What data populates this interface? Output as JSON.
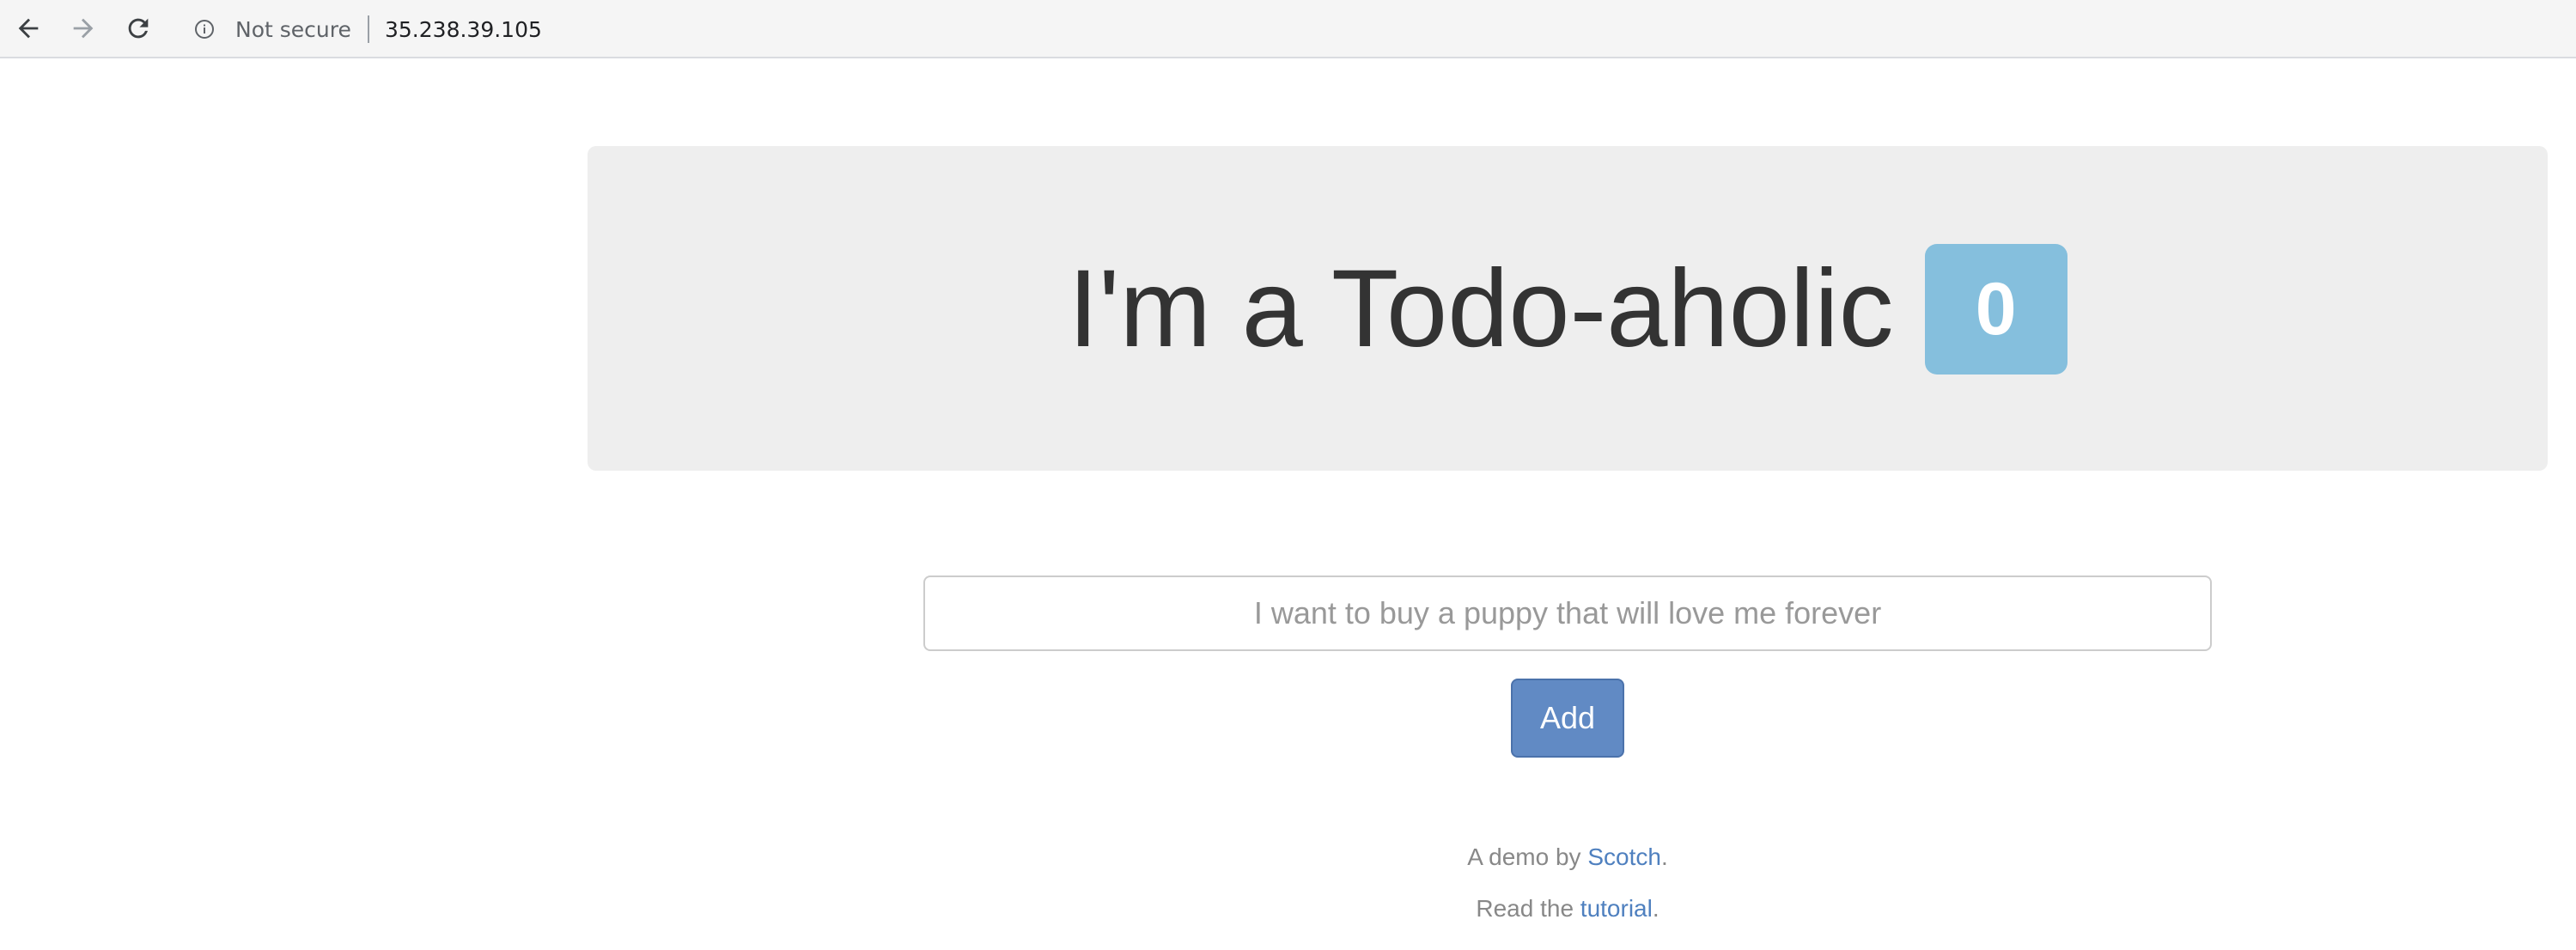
{
  "browser": {
    "security_label": "Not secure",
    "url": "35.238.39.105"
  },
  "icons": {
    "back": "arrow-left-icon",
    "forward": "arrow-right-icon",
    "reload": "reload-icon",
    "info": "info-icon"
  },
  "jumbotron": {
    "title": "I'm a Todo-aholic",
    "todo_count": "0"
  },
  "form": {
    "input_placeholder": "I want to buy a puppy that will love me forever",
    "input_value": "",
    "add_label": "Add"
  },
  "footer": {
    "demo_prefix": "A demo by ",
    "demo_link": "Scotch",
    "demo_suffix": ".",
    "read_prefix": "Read the ",
    "read_link": "tutorial",
    "read_suffix": "."
  },
  "colors": {
    "badge": "#85bfdd",
    "button": "#618ac4",
    "link": "#4f80bf",
    "jumbotron_bg": "#eeeeee"
  }
}
